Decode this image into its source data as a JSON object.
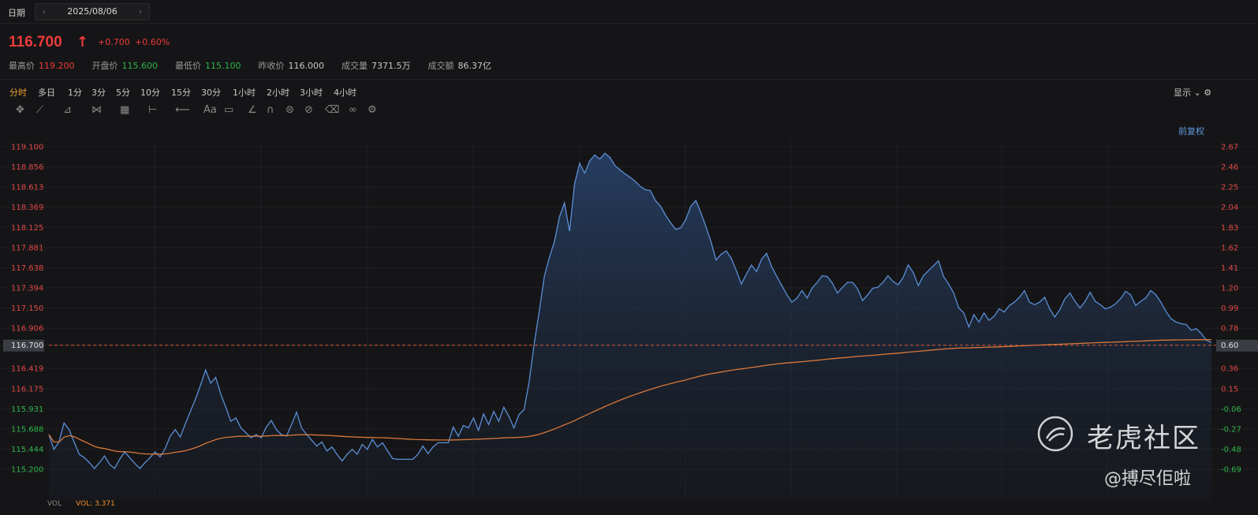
{
  "date_bar": {
    "label": "日期",
    "value": "2025/08/06",
    "prev": "‹",
    "next": "›"
  },
  "quote": {
    "price": "116.700",
    "change": "+0.700",
    "change_pct": "+0.60%",
    "stats": [
      {
        "label": "最高价",
        "value": "119.200",
        "color": "#ee3b3b"
      },
      {
        "label": "开盘价",
        "value": "115.600",
        "color": "#2fb34a"
      },
      {
        "label": "最低价",
        "value": "115.100",
        "color": "#2fb34a"
      },
      {
        "label": "昨收价",
        "value": "116.000",
        "color": "#c8c8c8"
      },
      {
        "label": "成交量",
        "value": "7371.5万",
        "color": "#c8c8c8"
      },
      {
        "label": "成交额",
        "value": "86.37亿",
        "color": "#c8c8c8"
      }
    ]
  },
  "periods": [
    "分时",
    "多日",
    "1分",
    "3分",
    "5分",
    "10分",
    "15分",
    "30分",
    "1小时",
    "2小时",
    "3小时",
    "4小时"
  ],
  "active_period": "分时",
  "display_label": "显示",
  "adjust_label": "前复权",
  "tools": [
    {
      "name": "crosshair-icon",
      "glyph": "✥"
    },
    {
      "name": "line-tool-icon",
      "glyph": "⟋"
    },
    {
      "name": "channel-tool-icon",
      "glyph": "⊿"
    },
    {
      "name": "wave-tool-icon",
      "glyph": "⋈"
    },
    {
      "name": "grid-tool-icon",
      "glyph": "▦"
    },
    {
      "name": "measure-tool-icon",
      "glyph": "⊢"
    },
    {
      "name": "arrow-tool-icon",
      "glyph": "⟵"
    },
    {
      "name": "text-tool-icon",
      "glyph": "Aa"
    },
    {
      "name": "comment-tool-icon",
      "glyph": "▭"
    },
    {
      "name": "pen-tool-icon",
      "glyph": "∠"
    },
    {
      "name": "magnet-icon",
      "glyph": "∩"
    },
    {
      "name": "eye-icon",
      "glyph": "⊜"
    },
    {
      "name": "hide-icon",
      "glyph": "⊘"
    },
    {
      "name": "trash-icon",
      "glyph": "⌫"
    },
    {
      "name": "link-icon",
      "glyph": "∞"
    },
    {
      "name": "settings-icon",
      "glyph": "⚙"
    }
  ],
  "watermark": {
    "brand": "老虎社区",
    "handle": "@搏尽佢啦"
  },
  "vol_strip": {
    "label": "VOL",
    "value": "VOL: 3.371"
  },
  "colors": {
    "price_line": "#5b8fd6",
    "avg_line": "#d9783a",
    "up": "#ee3b3b",
    "down": "#2fb34a",
    "ref_line": "#d9583a"
  },
  "chart_data": {
    "type": "line",
    "ylim": [
      115.2,
      119.1
    ],
    "ref_price": 116.7,
    "y_ticks": [
      "119.100",
      "118.856",
      "118.613",
      "118.369",
      "118.125",
      "117.881",
      "117.638",
      "117.394",
      "117.150",
      "116.906",
      "116.700",
      "116.419",
      "116.175",
      "115.931",
      "115.688",
      "115.444",
      "115.200"
    ],
    "right_ticks": [
      "2.67",
      "2.46",
      "2.25",
      "2.04",
      "1.83",
      "1.62",
      "1.41",
      "1.20",
      "0.99",
      "0.78",
      "0.60",
      "0.36",
      "0.15",
      "-0.06",
      "-0.27",
      "-0.48",
      "-0.69"
    ],
    "series": [
      {
        "values": [
          115.62,
          115.44,
          115.53,
          115.76,
          115.68,
          115.53,
          115.38,
          115.34,
          115.28,
          115.21,
          115.28,
          115.36,
          115.26,
          115.21,
          115.32,
          115.41,
          115.34,
          115.27,
          115.21,
          115.28,
          115.34,
          115.41,
          115.35,
          115.45,
          115.6,
          115.68,
          115.59,
          115.75,
          115.9,
          116.05,
          116.22,
          116.4,
          116.24,
          116.31,
          116.11,
          115.95,
          115.78,
          115.82,
          115.7,
          115.64,
          115.58,
          115.62,
          115.58,
          115.71,
          115.79,
          115.68,
          115.62,
          115.6,
          115.74,
          115.89,
          115.7,
          115.62,
          115.55,
          115.48,
          115.53,
          115.42,
          115.47,
          115.38,
          115.3,
          115.38,
          115.44,
          115.38,
          115.5,
          115.44,
          115.56,
          115.47,
          115.52,
          115.42,
          115.33,
          115.32,
          115.32,
          115.32,
          115.32,
          115.38,
          115.48,
          115.39,
          115.47,
          115.52,
          115.52,
          115.52,
          115.71,
          115.6,
          115.73,
          115.7,
          115.82,
          115.67,
          115.87,
          115.74,
          115.9,
          115.78,
          115.95,
          115.84,
          115.7,
          115.86,
          115.92,
          116.25,
          116.71,
          117.1,
          117.53,
          117.76,
          117.95,
          118.25,
          118.42,
          118.08,
          118.65,
          118.9,
          118.78,
          118.93,
          119.0,
          118.95,
          119.02,
          118.97,
          118.87,
          118.82,
          118.77,
          118.73,
          118.68,
          118.62,
          118.58,
          118.57,
          118.45,
          118.38,
          118.27,
          118.18,
          118.1,
          118.12,
          118.22,
          118.38,
          118.45,
          118.3,
          118.13,
          117.95,
          117.73,
          117.8,
          117.84,
          117.75,
          117.6,
          117.44,
          117.56,
          117.67,
          117.59,
          117.74,
          117.81,
          117.65,
          117.53,
          117.42,
          117.31,
          117.22,
          117.27,
          117.36,
          117.27,
          117.39,
          117.46,
          117.54,
          117.53,
          117.45,
          117.33,
          117.4,
          117.46,
          117.46,
          117.38,
          117.24,
          117.31,
          117.39,
          117.4,
          117.46,
          117.54,
          117.47,
          117.43,
          117.52,
          117.67,
          117.58,
          117.42,
          117.54,
          117.6,
          117.66,
          117.72,
          117.53,
          117.44,
          117.33,
          117.15,
          117.09,
          116.92,
          117.07,
          116.98,
          117.09,
          117.0,
          117.05,
          117.14,
          117.1,
          117.18,
          117.22,
          117.28,
          117.36,
          117.22,
          117.19,
          117.22,
          117.28,
          117.14,
          117.04,
          117.13,
          117.26,
          117.33,
          117.23,
          117.15,
          117.23,
          117.34,
          117.23,
          117.19,
          117.14,
          117.16,
          117.2,
          117.26,
          117.35,
          117.31,
          117.18,
          117.23,
          117.27,
          117.36,
          117.31,
          117.22,
          117.11,
          117.02,
          116.98,
          116.96,
          116.95,
          116.88,
          116.9,
          116.84,
          116.76,
          116.73
        ]
      }
    ]
  }
}
